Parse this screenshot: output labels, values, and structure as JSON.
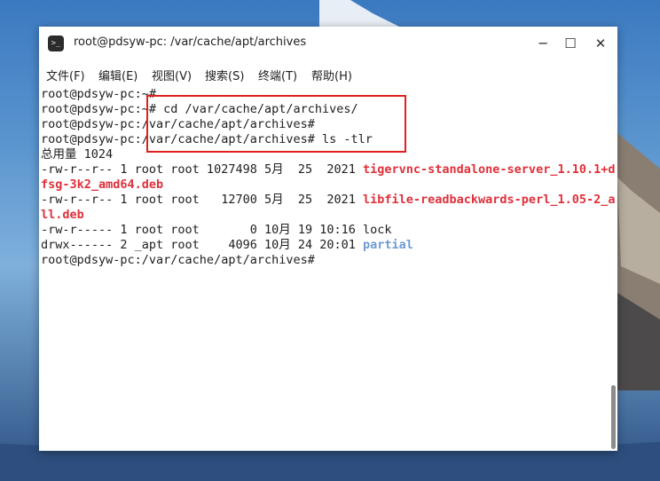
{
  "window": {
    "title": "root@pdsyw-pc: /var/cache/apt/archives",
    "app_icon_text": ">_"
  },
  "controls": {
    "minimize": "─",
    "maximize": "☐",
    "close": "✕"
  },
  "menu": {
    "items": [
      "文件(F)",
      "编辑(E)",
      "视图(V)",
      "搜索(S)",
      "终端(T)",
      "帮助(H)"
    ]
  },
  "terminal": {
    "line0": "root@pdsyw-pc:~#",
    "line1": "root@pdsyw-pc:~# cd /var/cache/apt/archives/",
    "line2": "root@pdsyw-pc:/var/cache/apt/archives#",
    "line3": "root@pdsyw-pc:/var/cache/apt/archives# ls -tlr",
    "line4": "总用量 1024",
    "entries": [
      {
        "meta": "-rw-r--r-- 1 root root 1027498 5月  25  2021 ",
        "name_part1": "tigervnc-standalone-server_1.10.1+d",
        "name_part2": "fsg-3k2_amd64.deb"
      },
      {
        "meta": "-rw-r--r-- 1 root root   12700 5月  25  2021 ",
        "name_part1": "libfile-readbackwards-perl_1.05-2_a",
        "name_part2": "ll.deb"
      },
      {
        "meta": "-rw-r----- 1 root root       0 10月 19 10:16 ",
        "name": "lock"
      },
      {
        "meta": "drwx------ 2 _apt root    4096 10月 24 20:01 ",
        "name": "partial"
      }
    ],
    "prompt_last": "root@pdsyw-pc:/var/cache/apt/archives#"
  },
  "colors": {
    "deb_file": "#e0303a",
    "directory": "#6f9bd4",
    "annotation_box": "#e02020"
  }
}
